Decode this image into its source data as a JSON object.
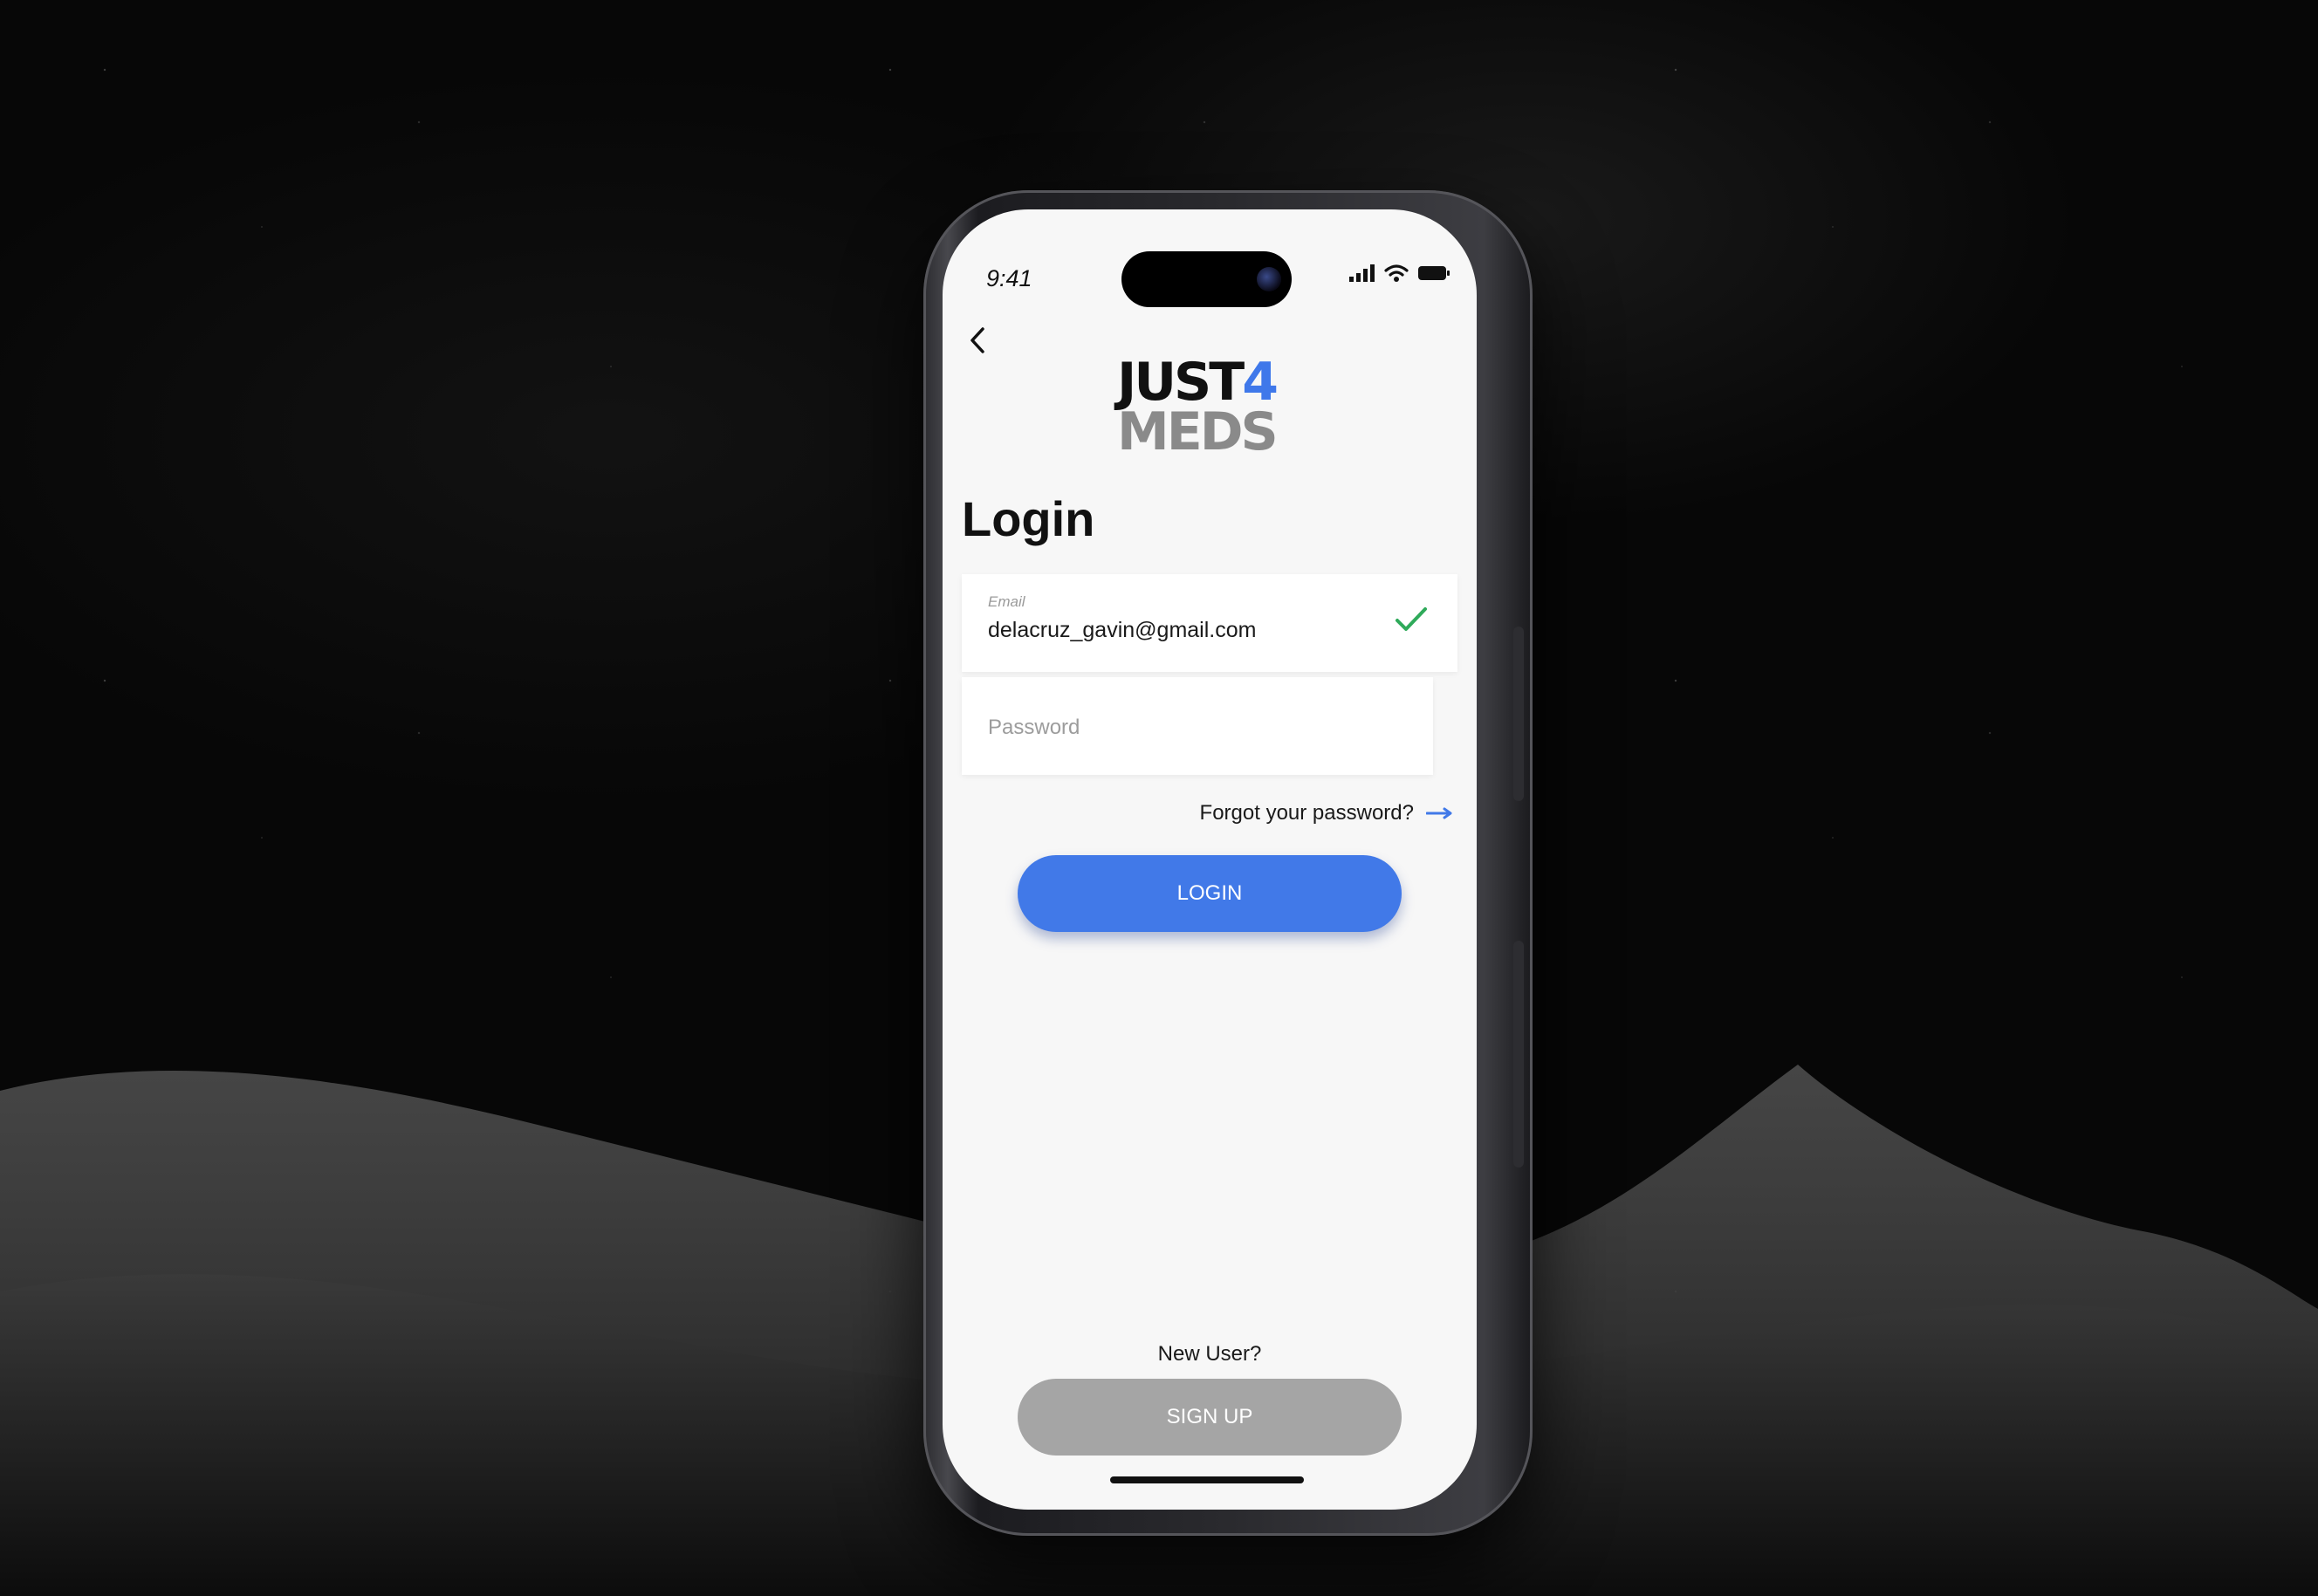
{
  "status_bar": {
    "time": "9:41"
  },
  "logo": {
    "line1_main": "JUST",
    "line1_accent": "4",
    "line2": "MEDS"
  },
  "page": {
    "title": "Login"
  },
  "form": {
    "email": {
      "label": "Email",
      "value": "delacruz_gavin@gmail.com"
    },
    "password": {
      "placeholder": "Password",
      "value": ""
    },
    "forgot_label": "Forgot your password?",
    "login_label": "LOGIN"
  },
  "footer": {
    "new_user_label": "New User?",
    "signup_label": "SIGN UP"
  },
  "colors": {
    "accent": "#4179e8",
    "check": "#2faa5a",
    "signup_button": "#a5a5a5",
    "screen_background": "#f7f7f7"
  },
  "icons": {
    "back": "chevron-left-icon",
    "valid": "checkmark-icon",
    "forgot_arrow": "arrow-right-icon",
    "signal": "signal-icon",
    "wifi": "wifi-icon",
    "battery": "battery-icon"
  }
}
